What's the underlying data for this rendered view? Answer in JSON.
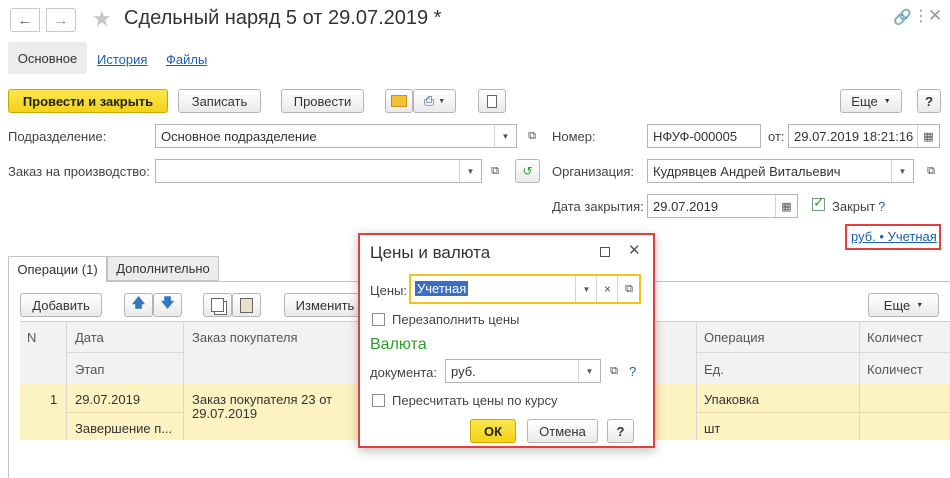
{
  "window": {
    "title": "Сдельный наряд 5 от 29.07.2019 *",
    "nav_tabs": [
      "Основное",
      "История",
      "Файлы"
    ]
  },
  "toolbar": {
    "post_close": "Провести и закрыть",
    "save": "Записать",
    "post": "Провести",
    "more": "Еще"
  },
  "form": {
    "division_label": "Подразделение:",
    "division_value": "Основное подразделение",
    "order_label": "Заказ на производство:",
    "order_value": "",
    "number_label": "Номер:",
    "number_value": "НФУФ-000005",
    "from_label": "от:",
    "from_value": "29.07.2019 18:21:16",
    "org_label": "Организация:",
    "org_value": "Кудрявцев Андрей Витальевич",
    "close_date_label": "Дата закрытия:",
    "close_date_value": "29.07.2019",
    "closed_label": "Закрыт",
    "closed_checked": true,
    "help": "?",
    "currency_link": "руб. • Учетная"
  },
  "tabs": [
    "Операции (1)",
    "Дополнительно"
  ],
  "table_toolbar": {
    "add": "Добавить",
    "change": "Изменить",
    "more": "Еще"
  },
  "table": {
    "headers_top": [
      "N",
      "Дата",
      "Заказ покупателя",
      "Операция",
      "Количест"
    ],
    "headers_bottom": [
      "Этап",
      "Ед.",
      "Количест"
    ],
    "row": {
      "n": "1",
      "date": "29.07.2019",
      "stage": "Завершение п...",
      "customer_order_line1": "Заказ покупателя 23 от",
      "customer_order_line2": "29.07.2019",
      "operation": "Упаковка",
      "unit": "шт"
    }
  },
  "dialog": {
    "title": "Цены и валюта",
    "prices_label": "Цены:",
    "prices_value": "Учетная",
    "refill_label": "Перезаполнить цены",
    "currency_heading": "Валюта",
    "doc_label": "документа:",
    "doc_value": "руб.",
    "help": "?",
    "recalc_label": "Пересчитать цены по курсу",
    "ok": "ОК",
    "cancel": "Отмена",
    "help_btn": "?",
    "clear": "×"
  },
  "colors": {
    "accent_yellow": "#f5d620",
    "link_blue": "#1a5fb4",
    "highlight_red": "#e04040",
    "row_selected": "#fdf3c2",
    "green": "#2e9e2e"
  }
}
